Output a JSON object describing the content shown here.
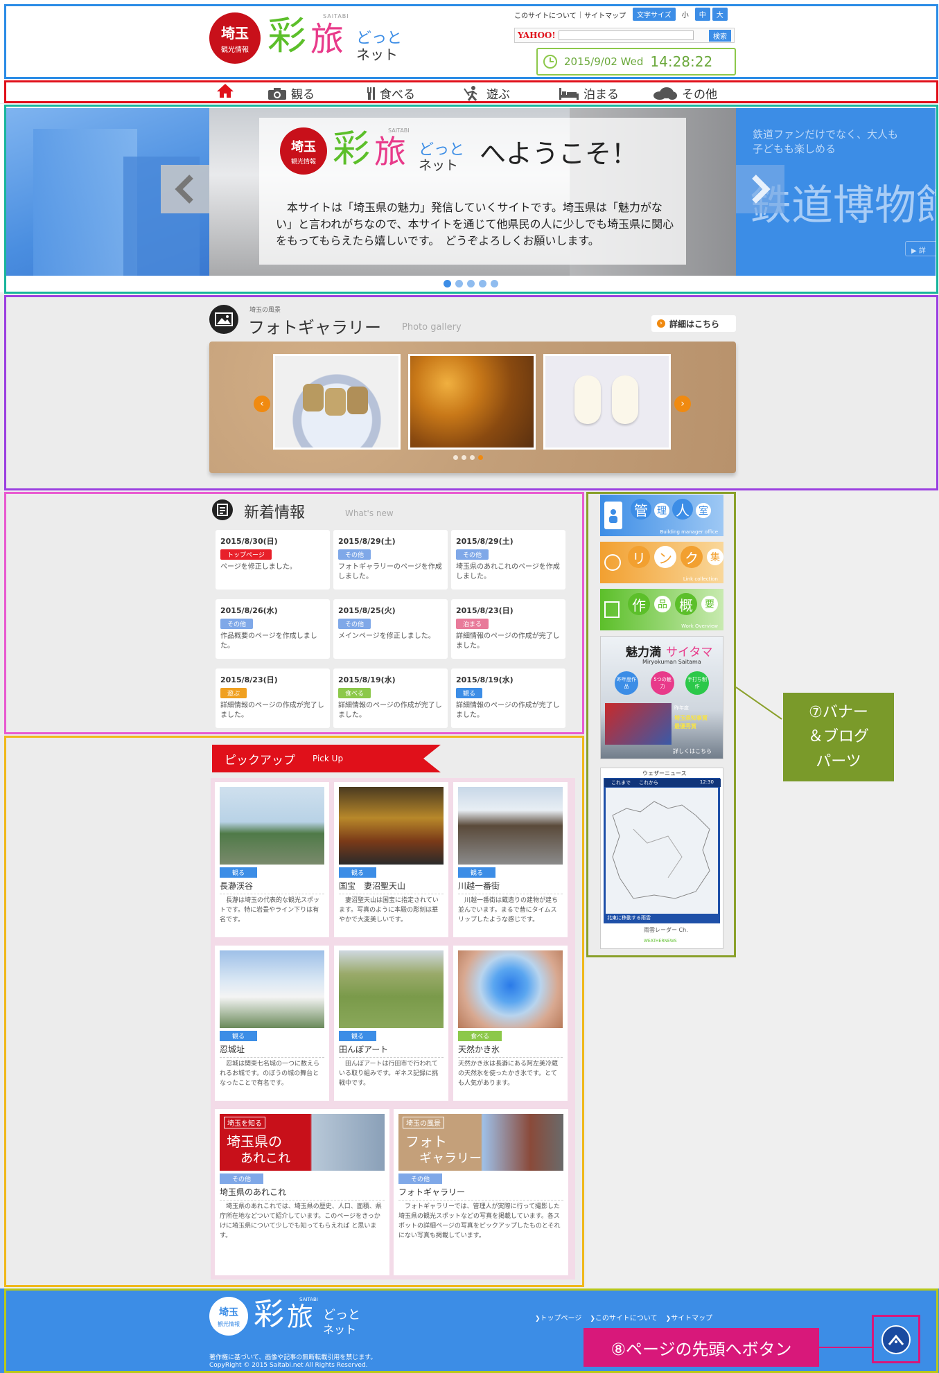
{
  "header": {
    "logo_seal_top": "埼玉",
    "logo_seal_bottom": "観光情報",
    "logo_small": "SAITABI",
    "logo_main_1": "彩",
    "logo_main_2": "旅",
    "logo_sub_1": "どっと",
    "logo_sub_2": "ネット",
    "link_about": "このサイトについて",
    "link_sitemap": "サイトマップ",
    "fontsize_label": "文字サイズ",
    "fontsize_small": "小",
    "fontsize_mid": "中",
    "fontsize_large": "大",
    "yahoo_label": "YAHOO!",
    "search_button": "検索",
    "clock_date": "2015/9/02 Wed",
    "clock_time": "14:28:22"
  },
  "nav": {
    "items": [
      {
        "label": "観る"
      },
      {
        "label": "食べる"
      },
      {
        "label": "遊ぶ"
      },
      {
        "label": "泊まる"
      },
      {
        "label": "その他"
      }
    ]
  },
  "hero": {
    "welcome": "へようこそ！",
    "body": "本サイトは「埼玉県の魅力」発信していくサイトです。埼玉県は「魅力がない」と言われがちなので、本サイトを通じて他県民の人に少しでも埼玉県に関心をもってもらえたら嬉しいです。　どうぞよろしくお願いします。",
    "next_text_1": "鉄道ファンだけでなく、大人も",
    "next_text_2": "子どもも楽しめる",
    "next_title": "鉄道博物館",
    "next_more": "▶ 詳"
  },
  "gallery": {
    "kicker": "埼玉の風景",
    "title": "フォトギャラリー",
    "subtitle": "Photo gallery",
    "detail_button": "詳細はこちら"
  },
  "news": {
    "title": "新着情報",
    "subtitle": "What's new",
    "items": [
      {
        "date": "2015/8/30(日)",
        "badge": "トップページ",
        "color": "#e8202a",
        "text": "ページを修正しました。"
      },
      {
        "date": "2015/8/29(土)",
        "badge": "その他",
        "color": "#7fa8e8",
        "text": "フォトギャラリーのページを作成しました。"
      },
      {
        "date": "2015/8/29(土)",
        "badge": "その他",
        "color": "#7fa8e8",
        "text": "埼玉県のあれこれのページを作成しました。"
      },
      {
        "date": "2015/8/26(水)",
        "badge": "その他",
        "color": "#7fa8e8",
        "text": "作品概要のページを作成しました。"
      },
      {
        "date": "2015/8/25(火)",
        "badge": "その他",
        "color": "#7fa8e8",
        "text": "メインページを修正しました。"
      },
      {
        "date": "2015/8/23(日)",
        "badge": "泊まる",
        "color": "#e87a9a",
        "text": "詳細情報のページの作成が完了しました。"
      },
      {
        "date": "2015/8/23(日)",
        "badge": "遊ぶ",
        "color": "#f0a020",
        "text": "詳細情報のページの作成が完了しました。"
      },
      {
        "date": "2015/8/19(水)",
        "badge": "食べる",
        "color": "#8cc84a",
        "text": "詳細情報のページの作成が完了しました。"
      },
      {
        "date": "2015/8/19(水)",
        "badge": "観る",
        "color": "#3c8de6",
        "text": "詳細情報のページの作成が完了しました。"
      }
    ]
  },
  "pickup": {
    "title": "ピックアップ",
    "subtitle": "Pick Up",
    "items": [
      {
        "badge": "観る",
        "color": "#3c8de6",
        "title": "長瀞渓谷",
        "desc": "　長瀞は埼玉の代表的な観光スポットです。特に岩畳やライン下りは有名です。"
      },
      {
        "badge": "観る",
        "color": "#3c8de6",
        "title": "国宝　妻沼聖天山",
        "desc": "　妻沼聖天山は国宝に指定されています。写真のように本殿の彫刻は華やかで大変美しいです。"
      },
      {
        "badge": "観る",
        "color": "#3c8de6",
        "title": "川越一番街",
        "desc": "　川越一番街は蔵造りの建物が建ち並んでいます。まるで昔にタイムスリップしたような感じです。"
      },
      {
        "badge": "観る",
        "color": "#3c8de6",
        "title": "忍城址",
        "desc": "　忍城は関東七名城の一つに数えられるお城です。のぼうの城の舞台となったことで有名です。"
      },
      {
        "badge": "観る",
        "color": "#3c8de6",
        "title": "田んぼアート",
        "desc": "　田んぼアートは行田市で行われている取り組みです。ギネス記録に挑戦中です。"
      },
      {
        "badge": "食べる",
        "color": "#8cc84a",
        "title": "天然かき氷",
        "desc": "天然かき氷は長瀞にある阿左美冷蔵の天然氷を使ったかき氷です。とても人気があります。"
      },
      {
        "badge": "その他",
        "color": "#7fa8e8",
        "title": "埼玉県のあれこれ",
        "desc": "　埼玉県のあれこれでは、埼玉県の歴史、人口、面積、県庁所在地などついて紹介しています。このページをきっかけに埼玉県について少しでも知ってもらえれば と思います。"
      },
      {
        "badge": "その他",
        "color": "#7fa8e8",
        "title": "フォトギャラリー",
        "desc": "　フォトギャラリーでは、管理人が実際に行って撮影した埼玉県の観光スポットなどの写真を掲載しています。各スポットの詳細ページの写真をピックアップしたものとそれにない写真も掲載しています。"
      }
    ],
    "promo1_kicker": "埼玉を知る",
    "promo1_title_1": "埼玉県の",
    "promo1_title_2": "あれこれ",
    "promo2_kicker": "埼玉の風景",
    "promo2_title_1": "フォト",
    "promo2_title_2": "ギャラリー"
  },
  "sidebar": {
    "b1_chars": [
      "管",
      "理",
      "人",
      "室"
    ],
    "b1_sub": "Building manager office",
    "b2_chars": [
      "リ",
      "ン",
      "ク",
      "集"
    ],
    "b2_sub": "Link collection",
    "b3_chars": [
      "作",
      "品",
      "概",
      "要"
    ],
    "b3_sub": "Work Overview",
    "b4_title_1": "魅力満",
    "b4_title_2": "サイタマ",
    "b4_romaji": "Miryokuman Saitama",
    "b4_circle_1": "昨年度作品",
    "b4_circle_2": "5つの魅力",
    "b4_circle_3": "手打ち制作",
    "b4_tag_1": "昨年度",
    "b4_tag_2": "埼玉県知事賞",
    "b4_tag_3": "最優秀賞",
    "b4_more": "詳しくはこちら",
    "weather_title": "ウェザーニュース",
    "weather_tab_1": "これまで",
    "weather_tab_2": "これから",
    "weather_time": "12:30",
    "weather_caption": "北東に移動する雨雲",
    "weather_footer": "雨雲レーダー Ch.",
    "weather_brand": "WEATHERNEWS"
  },
  "annotations": {
    "banner_label_1": "⑦バナー",
    "banner_label_2": "＆ブログ",
    "banner_label_3": "パーツ",
    "totop_label": "⑧ページの先頭へボタン"
  },
  "footer": {
    "link_top": "トップページ",
    "link_about": "このサイトについて",
    "link_sitemap": "サイトマップ",
    "notice": "著作権に基づいて、画像や記事の無断転載引用を禁じます。",
    "copyright": "CopyRight © 2015 Saitabi.net All Rights Reserved."
  },
  "colors": {
    "brand_red": "#c8101a",
    "brand_blue": "#3c8de6",
    "logo_green": "#5cbf2a",
    "logo_pink": "#e83a8a",
    "frame_blue": "#2b8ce6",
    "frame_red": "#e0101a",
    "frame_teal": "#19b59c",
    "frame_purple": "#9b3fe0",
    "frame_pink": "#e85ad0",
    "frame_yellow": "#f0b81a",
    "frame_olive": "#8aa02a"
  },
  "icons": [
    "home-icon",
    "camera-icon",
    "fork-icon",
    "walk-icon",
    "bed-icon",
    "cloud-icon",
    "clock-icon",
    "chevron-left-icon",
    "chevron-right-icon",
    "gallery-icon",
    "news-icon",
    "to-top-icon"
  ]
}
